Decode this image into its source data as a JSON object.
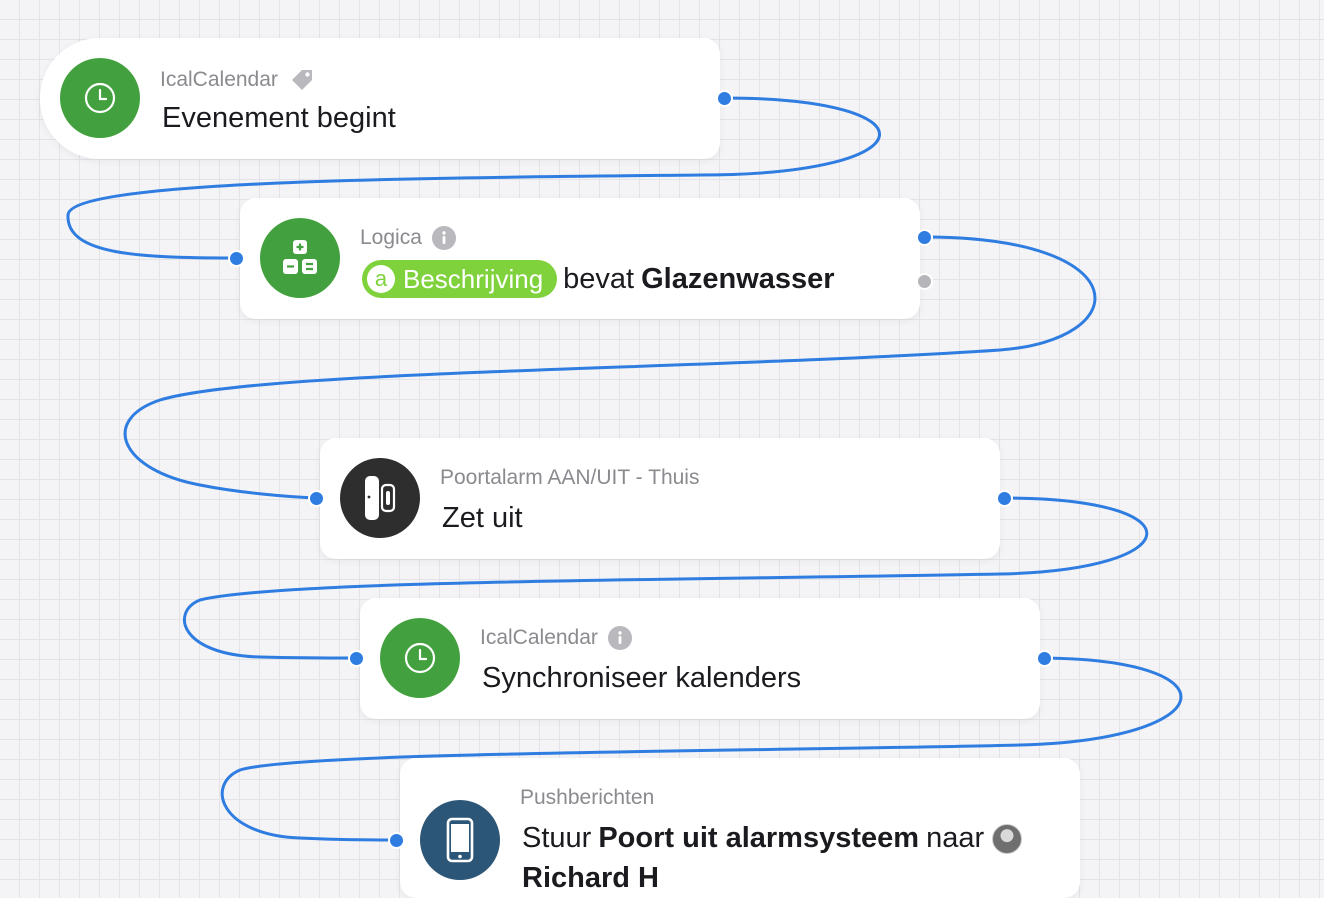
{
  "flow": {
    "cards": [
      {
        "subtitle": "IcalCalendar",
        "title": "Evenement begint",
        "icon": "clock-icon",
        "badge_icon": "tag-icon",
        "color": "#43a03e"
      },
      {
        "subtitle": "Logica",
        "icon": "calculator-icon",
        "badge_icon": "info-icon",
        "color": "#43a03e",
        "token": {
          "letter": "a",
          "label": "Beschrijving"
        },
        "operator": "bevat",
        "value": "Glazenwasser"
      },
      {
        "subtitle": "Poortalarm AAN/UIT - Thuis",
        "title": "Zet uit",
        "icon": "door-sensor-icon",
        "color": "#2e2e2e"
      },
      {
        "subtitle": "IcalCalendar",
        "title": "Synchroniseer kalenders",
        "icon": "clock-icon",
        "badge_icon": "info-icon",
        "color": "#43a03e"
      },
      {
        "subtitle": "Pushberichten",
        "icon": "phone-icon",
        "color": "#2c5678",
        "prefix": "Stuur",
        "message": "Poort uit alarmsysteem",
        "connector": "naar",
        "recipient": "Richard H"
      }
    ],
    "wire_color": "#2f7de1"
  }
}
